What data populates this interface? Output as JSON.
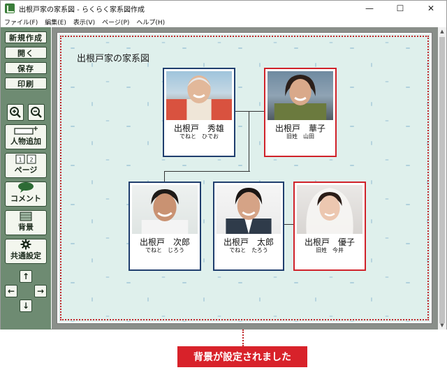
{
  "window": {
    "title": "出根戸家の家系図 - らくらく家系図作成",
    "minimize": "—",
    "maximize": "☐",
    "close": "✕"
  },
  "menu": [
    "ファイル(F)",
    "編集(E)",
    "表示(V)",
    "ページ(P)",
    "ヘルプ(H)"
  ],
  "toolbar": {
    "new": "新規作成",
    "open": "開く",
    "save": "保存",
    "print": "印刷",
    "add_person": "人物追加",
    "page": "ページ",
    "comment": "コメント",
    "background": "背景",
    "common_settings": "共通設定",
    "page_icon_left": "1",
    "page_icon_right": "2"
  },
  "canvas": {
    "title": "出根戸家の家系図"
  },
  "persons": [
    {
      "name": "出根戸　秀雄",
      "sub": "でねと　ひでお",
      "gender": "male"
    },
    {
      "name": "出根戸　華子",
      "sub": "旧姓　山田",
      "gender": "female"
    },
    {
      "name": "出根戸　次郎",
      "sub": "でねと　じろう",
      "gender": "male"
    },
    {
      "name": "出根戸　太郎",
      "sub": "でねと　たろう",
      "gender": "male"
    },
    {
      "name": "出根戸　優子",
      "sub": "旧姓　今井",
      "gender": "female"
    }
  ],
  "status_banner": "背景が設定されました",
  "colors": {
    "male_border": "#1f3e6e",
    "female_border": "#d0222a",
    "sidebar": "#6e8b72",
    "banner": "#d8222a"
  }
}
